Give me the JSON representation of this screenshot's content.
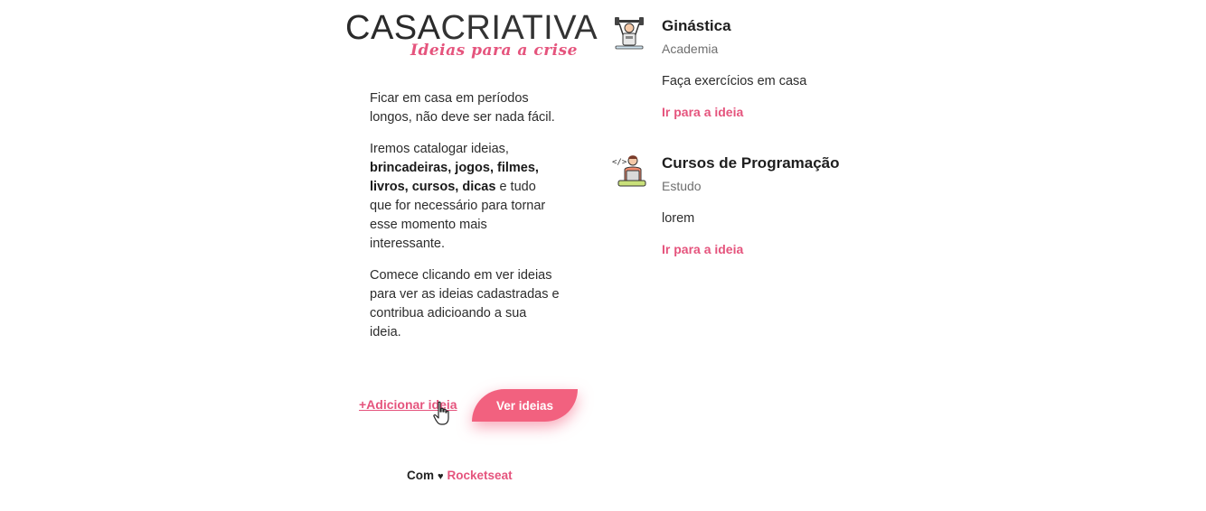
{
  "logo": {
    "part1": "CASA",
    "part2": "CRIATIVA",
    "tagline": "Ideias para a crise"
  },
  "intro": {
    "p1": "Ficar em casa em períodos longos, não deve ser nada fácil.",
    "p2_before": "Iremos catalogar ideias, ",
    "p2_bold": "brincadeiras, jogos, filmes, livros, cursos, dicas",
    "p2_after": " e tudo que for necessário para tornar esse momento mais interessante.",
    "p3": "Comece clicando em ver ideias para ver as ideias cadastradas e contribua adicioando a sua ideia."
  },
  "actions": {
    "add_label": "+Adicionar ideia",
    "view_label": "Ver ideias"
  },
  "footer": {
    "prefix": "Com",
    "heart": "♥",
    "brand": "Rocketseat"
  },
  "ideas": [
    {
      "icon": "gym-icon",
      "title": "Ginástica",
      "category": "Academia",
      "description": "Faça exercícios em casa",
      "link_label": "Ir para a ideia"
    },
    {
      "icon": "programmer-icon",
      "title": "Cursos de Programação",
      "category": "Estudo",
      "description": "lorem",
      "link_label": "Ir para a ideia"
    }
  ],
  "colors": {
    "accent": "#e5547d",
    "button": "#f2617f",
    "text": "#2c2c2c"
  }
}
